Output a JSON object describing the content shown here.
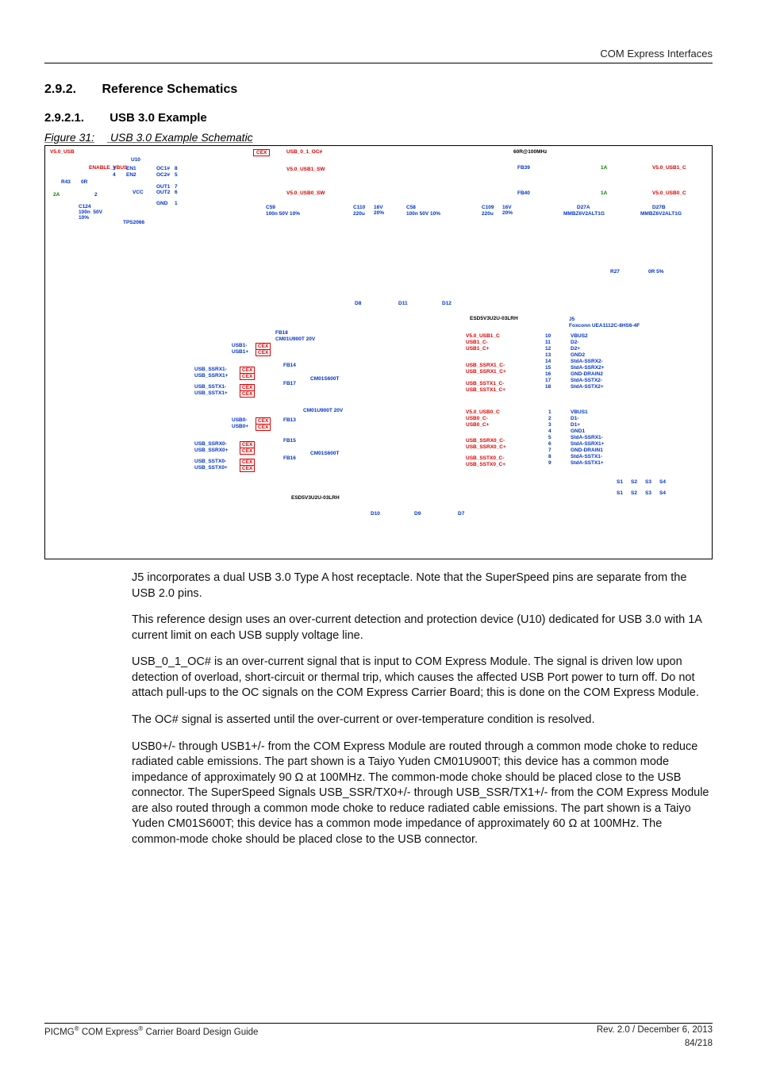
{
  "running_head": "COM Express Interfaces",
  "section_a": {
    "num": "2.9.2.",
    "title": "Reference Schematics"
  },
  "section_b": {
    "num": "2.9.2.1.",
    "title": "USB 3.0 Example"
  },
  "figure_caption": {
    "num": "Figure 31:",
    "title": "USB 3.0 Example Schematic"
  },
  "schematic": {
    "power_net": "V5.0_USB",
    "enable_net": "ENABLE_VBUS",
    "R43": {
      "ref": "R43",
      "val": "0R"
    },
    "R27": {
      "ref": "R27",
      "val": "0R  5%"
    },
    "C124": {
      "ref": "C124",
      "vals": "100n  50V\n10%"
    },
    "U10": {
      "ref": "U10",
      "part": "TPS2066",
      "pins": {
        "EN1": "3",
        "EN2": "4",
        "VCC": "2",
        "GND": "1",
        "OC1#": "8",
        "OC2#": "5",
        "OUT1": "7",
        "OUT2": "6"
      }
    },
    "current_spec_in": "2A",
    "oc_net": "USB_0_1_OC#",
    "oc_tag": "CEX",
    "switched": {
      "sw1": "V5.0_USB1_SW",
      "sw0": "V5.0_USB0_SW"
    },
    "C59": {
      "ref": "C59",
      "vals": "100n 50V 10%"
    },
    "C110": {
      "ref": "C110",
      "vals": "220u",
      "extra": "16V\n20%"
    },
    "C58": {
      "ref": "C58",
      "vals": "100n  50V 10%"
    },
    "C109": {
      "ref": "C109",
      "vals": "220u",
      "extra": "16V\n20%"
    },
    "fb_header": "60R@100MHz",
    "FB39": {
      "ref": "FB39",
      "spec": "1A",
      "out": "V5.0_USB1_C"
    },
    "FB40": {
      "ref": "FB40",
      "spec": "1A",
      "out": "V5.0_USB0_C"
    },
    "D27A": {
      "ref": "D27A",
      "part": "MMBZ6V2ALT1G"
    },
    "D27B": {
      "ref": "D27B",
      "part": "MMBZ6V2ALT1G"
    },
    "ESD_top": "ESD5V3U2U-03LRH",
    "ESD_bot": "ESD5V3U2U-03LRH",
    "D_top": [
      "D8",
      "D11",
      "D12"
    ],
    "D_bot": [
      "D10",
      "D9",
      "D7"
    ],
    "FB18": {
      "ref": "FB18",
      "part": "CM01U900T  20V"
    },
    "FB13": {
      "ref": "FB13",
      "part": "CM01U900T  20V"
    },
    "FB14": {
      "ref": "FB14",
      "part": "CM01S600T"
    },
    "FB17": {
      "ref": "FB17"
    },
    "FB15": {
      "ref": "FB15",
      "part": "CM01S600T"
    },
    "FB16": {
      "ref": "FB16"
    },
    "cex": "CEX",
    "usb1_pairs_in": [
      "USB1-",
      "USB1+"
    ],
    "usb0_pairs_in": [
      "USB0-",
      "USB0+"
    ],
    "ss_rx1_in": [
      "USB_SSRX1-",
      "USB_SSRX1+"
    ],
    "ss_tx1_in": [
      "USB_SSTX1-",
      "USB_SSTX1+"
    ],
    "ss_rx0_in": [
      "USB_SSRX0-",
      "USB_SSRX0+"
    ],
    "ss_tx0_in": [
      "USB_SSTX0-",
      "USB_SSTX0+"
    ],
    "usb1_c": [
      "V5.0_USB1_C",
      "USB1_C-",
      "USB1_C+"
    ],
    "usb0_c": [
      "V5.0_USB0_C",
      "USB0_C-",
      "USB0_C+"
    ],
    "ss_rx1_c": [
      "USB_SSRX1_C-",
      "USB_SSRX1_C+"
    ],
    "ss_tx1_c": [
      "USB_SSTX1_C-",
      "USB_SSTX1_C+"
    ],
    "ss_rx0_c": [
      "USB_SSRX0_C-",
      "USB_SSRX0_C+"
    ],
    "ss_tx0_c": [
      "USB_SSTX0_C-",
      "USB_SSTX0_C+"
    ],
    "J5": {
      "ref": "J5",
      "part": "Foxconn UEA1112C-8HS6-4F",
      "port2_pins": {
        "10": "VBUS2",
        "11": "D2-",
        "12": "D2+",
        "13": "GND2",
        "14": "StdA-SSRX2-",
        "15": "StdA-SSRX2+",
        "16": "GND-DRAIN2",
        "17": "StdA-SSTX2-",
        "18": "StdA-SSTX2+"
      },
      "port1_pins": {
        "1": "VBUS1",
        "2": "D1-",
        "3": "D1+",
        "4": "GND1",
        "5": "StdA-SSRX1-",
        "6": "StdA-SSRX1+",
        "7": "GND-DRAIN1",
        "8": "StdA-SSTX1-",
        "9": "StdA-SSTX1+"
      },
      "shields": [
        "S1",
        "S2",
        "S3",
        "S4"
      ]
    }
  },
  "para": [
    "J5 incorporates a dual USB 3.0 Type A host receptacle.  Note that the SuperSpeed pins are separate from the USB 2.0 pins.",
    "This reference design uses an over-current detection and protection device (U10) dedicated for USB 3.0 with 1A current limit on each USB supply voltage line.",
    "USB_0_1_OC# is an over-current signal that is input to COM Express Module.  The signal is driven low upon detection of overload, short-circuit or thermal trip, which causes the affected USB Port power to turn off.  Do not attach pull-ups to the OC signals on the COM Express Carrier Board; this is done on the COM Express Module.",
    "The OC# signal is asserted until the over-current or over-temperature condition is resolved.",
    "USB0+/- through USB1+/- from the COM Express Module are routed through a common mode choke to reduce radiated cable emissions.  The part shown is a Taiyo Yuden CM01U900T; this device has a common mode impedance of approximately 90 Ω at 100MHz.  The common-mode choke should be placed close to the USB connector.  The SuperSpeed Signals USB_SSR/TX0+/- through USB_SSR/TX1+/- from the COM Express Module are also routed through a common mode choke to reduce radiated cable emissions.  The part shown is a Taiyo Yuden CM01S600T; this device has a common mode impedance of approximately 60 Ω at 100MHz.  The common-mode choke should be placed close to the USB connector."
  ],
  "footer": {
    "left": "PICMG® COM Express® Carrier Board Design Guide",
    "right": "Rev. 2.0 / December 6, 2013",
    "page": "84/218"
  }
}
